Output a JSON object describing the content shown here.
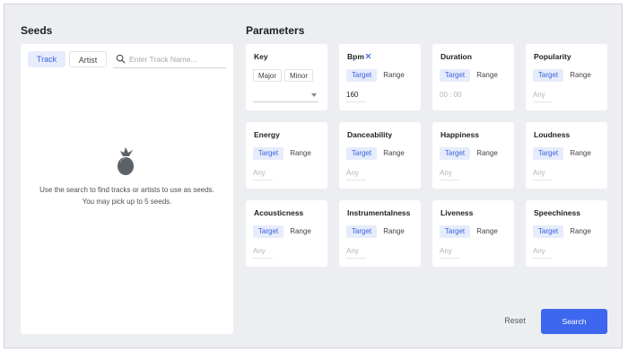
{
  "seeds": {
    "title": "Seeds",
    "tabs": {
      "track": "Track",
      "artist": "Artist"
    },
    "search_placeholder": "Enter Track Name...",
    "empty_message": "Use the search to find tracks or artists to use as seeds. You may pick up to 5 seeds."
  },
  "parameters": {
    "title": "Parameters",
    "target_label": "Target",
    "range_label": "Range",
    "any_placeholder": "Any",
    "key": {
      "title": "Key",
      "major": "Major",
      "minor": "Minor"
    },
    "bpm": {
      "title": "Bpm",
      "value": "160"
    },
    "duration": {
      "title": "Duration",
      "time": "00 : 00"
    },
    "popularity": {
      "title": "Popularity"
    },
    "energy": {
      "title": "Energy"
    },
    "danceability": {
      "title": "Danceability"
    },
    "happiness": {
      "title": "Happiness"
    },
    "loudness": {
      "title": "Loudness"
    },
    "acousticness": {
      "title": "Acousticness"
    },
    "instrumentalness": {
      "title": "Instrumentalness"
    },
    "liveness": {
      "title": "Liveness"
    },
    "speechiness": {
      "title": "Speechiness"
    }
  },
  "actions": {
    "reset": "Reset",
    "search": "Search"
  },
  "colors": {
    "accent": "#3d67ee",
    "selected_bg": "#e6ecfb",
    "panel_bg": "#eceef1"
  }
}
